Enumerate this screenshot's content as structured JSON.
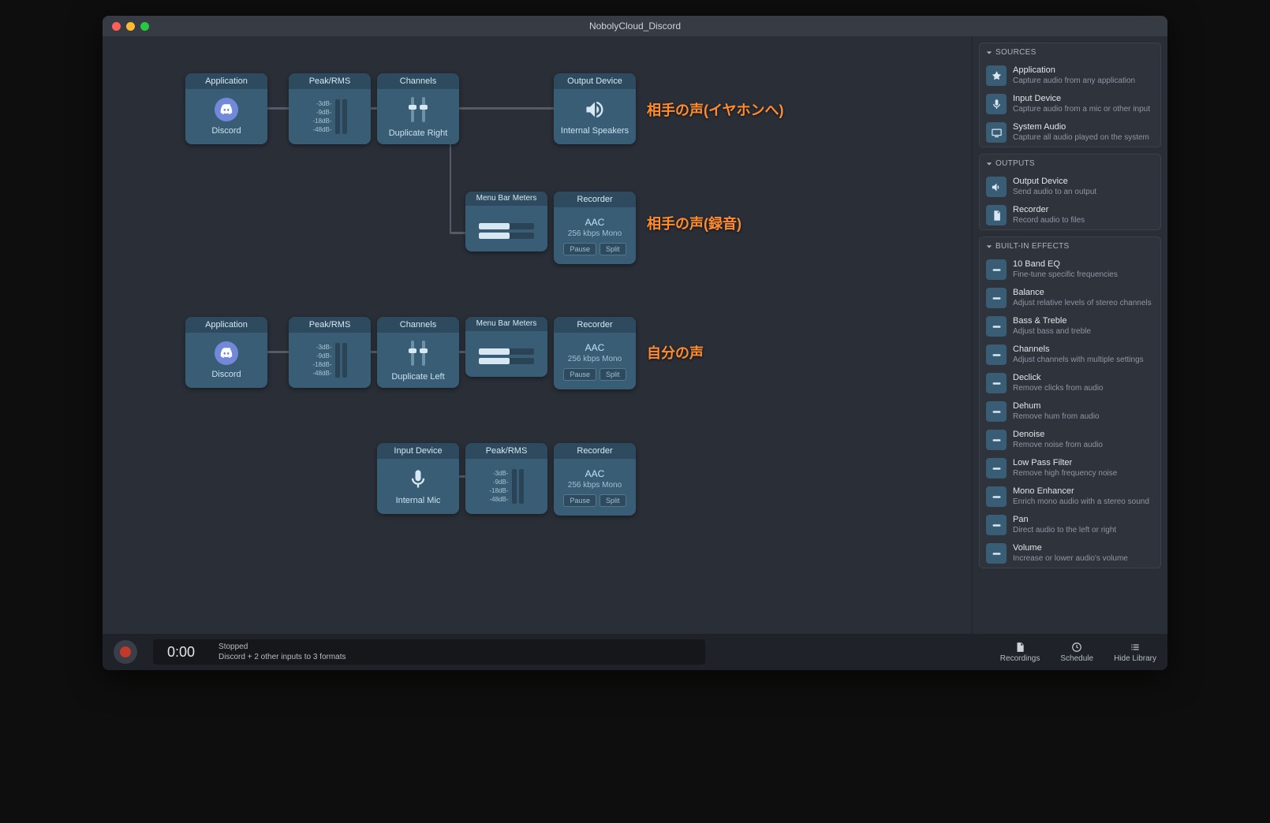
{
  "window": {
    "title": "NobolyCloud_Discord"
  },
  "annotations": {
    "a1": "相手の声(イヤホンへ)",
    "a2": "相手の声(録音)",
    "a3": "自分の声"
  },
  "meter_labels": [
    "-3dB-",
    "-9dB-",
    "-18dB-",
    "-48dB-"
  ],
  "row1": {
    "app": {
      "title": "Application",
      "label": "Discord"
    },
    "peak": {
      "title": "Peak/RMS"
    },
    "channels": {
      "title": "Channels",
      "label": "Duplicate Right"
    },
    "output": {
      "title": "Output Device",
      "label": "Internal Speakers"
    },
    "menubar": {
      "title": "Menu Bar Meters"
    },
    "recorder": {
      "title": "Recorder",
      "format": "AAC",
      "rate": "256 kbps Mono",
      "pause": "Pause",
      "split": "Split"
    }
  },
  "row2": {
    "app": {
      "title": "Application",
      "label": "Discord"
    },
    "peak": {
      "title": "Peak/RMS"
    },
    "channels": {
      "title": "Channels",
      "label": "Duplicate Left"
    },
    "menubar": {
      "title": "Menu Bar Meters"
    },
    "recorder": {
      "title": "Recorder",
      "format": "AAC",
      "rate": "256 kbps Mono",
      "pause": "Pause",
      "split": "Split"
    }
  },
  "row3": {
    "input": {
      "title": "Input Device",
      "label": "Internal Mic"
    },
    "peak": {
      "title": "Peak/RMS"
    },
    "recorder": {
      "title": "Recorder",
      "format": "AAC",
      "rate": "256 kbps Mono",
      "pause": "Pause",
      "split": "Split"
    }
  },
  "sidebar": {
    "sources": {
      "heading": "SOURCES",
      "items": [
        {
          "name": "Application",
          "sub": "Capture audio from any application"
        },
        {
          "name": "Input Device",
          "sub": "Capture audio from a mic or other input"
        },
        {
          "name": "System Audio",
          "sub": "Capture all audio played on the system"
        }
      ]
    },
    "outputs": {
      "heading": "OUTPUTS",
      "items": [
        {
          "name": "Output Device",
          "sub": "Send audio to an output"
        },
        {
          "name": "Recorder",
          "sub": "Record audio to files"
        }
      ]
    },
    "effects": {
      "heading": "BUILT-IN EFFECTS",
      "items": [
        {
          "name": "10 Band EQ",
          "sub": "Fine-tune specific frequencies"
        },
        {
          "name": "Balance",
          "sub": "Adjust relative levels of stereo channels"
        },
        {
          "name": "Bass & Treble",
          "sub": "Adjust bass and treble"
        },
        {
          "name": "Channels",
          "sub": "Adjust channels with multiple settings"
        },
        {
          "name": "Declick",
          "sub": "Remove clicks from audio"
        },
        {
          "name": "Dehum",
          "sub": "Remove hum from audio"
        },
        {
          "name": "Denoise",
          "sub": "Remove noise from audio"
        },
        {
          "name": "Low Pass Filter",
          "sub": "Remove high frequency noise"
        },
        {
          "name": "Mono Enhancer",
          "sub": "Enrich mono audio with a stereo sound"
        },
        {
          "name": "Pan",
          "sub": "Direct audio to the left or right"
        },
        {
          "name": "Volume",
          "sub": "Increase or lower audio's volume"
        }
      ]
    }
  },
  "footer": {
    "time": "0:00",
    "status1": "Stopped",
    "status2": "Discord + 2 other inputs to 3 formats",
    "recordings": "Recordings",
    "schedule": "Schedule",
    "hide": "Hide Library"
  }
}
